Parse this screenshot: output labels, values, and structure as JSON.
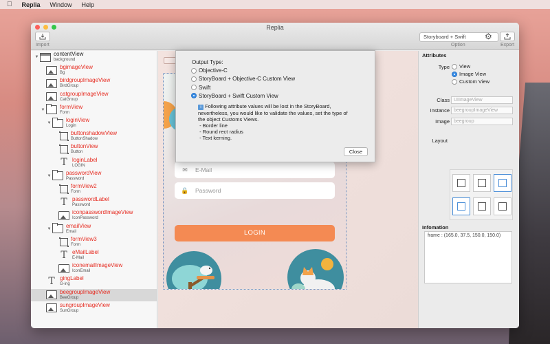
{
  "menubar": {
    "app": "Replia",
    "items": [
      "Window",
      "Help"
    ]
  },
  "window": {
    "title": "Replia",
    "toolbar": {
      "import_label": "Import",
      "option_label": "Option",
      "export_label": "Export",
      "output_selector": "Storyboard + Swift"
    }
  },
  "tree": [
    {
      "name": "contentView",
      "sub": "background",
      "icon": "view",
      "depth": 0,
      "disc": "open",
      "color": "black"
    },
    {
      "name": "bgimageView",
      "sub": "Bg",
      "icon": "image",
      "depth": 1,
      "disc": "",
      "color": "red"
    },
    {
      "name": "birdgroupImageView",
      "sub": "BirdGroup",
      "icon": "image",
      "depth": 1,
      "disc": "",
      "color": "red"
    },
    {
      "name": "catgroupImageView",
      "sub": "CatGroup",
      "icon": "image",
      "depth": 1,
      "disc": "",
      "color": "red"
    },
    {
      "name": "formView",
      "sub": "Form",
      "icon": "folder",
      "depth": 1,
      "disc": "open",
      "color": "red"
    },
    {
      "name": "loginView",
      "sub": "Login",
      "icon": "folder",
      "depth": 2,
      "disc": "open",
      "color": "red"
    },
    {
      "name": "buttonshadowView",
      "sub": "ButtonShadow",
      "icon": "button",
      "depth": 3,
      "disc": "",
      "color": "red"
    },
    {
      "name": "buttonView",
      "sub": "Button",
      "icon": "button",
      "depth": 3,
      "disc": "",
      "color": "red"
    },
    {
      "name": "loginLabel",
      "sub": "LOGIN",
      "icon": "text",
      "depth": 3,
      "disc": "",
      "color": "red"
    },
    {
      "name": "passwordView",
      "sub": "Password",
      "icon": "folder",
      "depth": 2,
      "disc": "open",
      "color": "red"
    },
    {
      "name": "formView2",
      "sub": "Form",
      "icon": "button",
      "depth": 3,
      "disc": "",
      "color": "red"
    },
    {
      "name": "passwordLabel",
      "sub": "Password",
      "icon": "text",
      "depth": 3,
      "disc": "",
      "color": "red"
    },
    {
      "name": "iconpasswordImageView",
      "sub": "IconPassword",
      "icon": "image",
      "depth": 3,
      "disc": "",
      "color": "red"
    },
    {
      "name": "emailView",
      "sub": "Email",
      "icon": "folder",
      "depth": 2,
      "disc": "open",
      "color": "red"
    },
    {
      "name": "formView3",
      "sub": "Form",
      "icon": "button",
      "depth": 3,
      "disc": "",
      "color": "red"
    },
    {
      "name": "eMailLabel",
      "sub": "E-Mail",
      "icon": "text",
      "depth": 3,
      "disc": "",
      "color": "red"
    },
    {
      "name": "iconemailImageView",
      "sub": "IconEmail",
      "icon": "image",
      "depth": 3,
      "disc": "",
      "color": "red"
    },
    {
      "name": "gingLabel",
      "sub": "G-ing",
      "icon": "text",
      "depth": 1,
      "disc": "",
      "color": "red"
    },
    {
      "name": "beegroupImageView",
      "sub": "BeeGroup",
      "icon": "image",
      "depth": 1,
      "disc": "",
      "color": "red",
      "selected": true
    },
    {
      "name": "sungroupImageView",
      "sub": "SunGroup",
      "icon": "image",
      "depth": 1,
      "disc": "",
      "color": "red"
    }
  ],
  "canvas": {
    "email_placeholder": "E-Mail",
    "password_placeholder": "Password",
    "login_button": "LOGIN"
  },
  "popup": {
    "heading": "Output Type:",
    "options": [
      {
        "label": "Objective-C",
        "selected": false
      },
      {
        "label": "StoryBoard + Objective-C Custom View",
        "selected": false
      },
      {
        "label": "Swift",
        "selected": false
      },
      {
        "label": "StoryBoard + Swift Custom View",
        "selected": true
      }
    ],
    "info_lines": [
      "Following attribute values will be lost in the StoryBoard,",
      "nevertheless, you would like to validate the values, set the type of",
      "the object Customs Views.",
      "- Border line",
      "- Round rect radius",
      "- Text kerning."
    ],
    "close_label": "Close"
  },
  "inspector": {
    "attributes_title": "Attributes",
    "type_label": "Type",
    "type_options": [
      {
        "label": "View",
        "selected": false
      },
      {
        "label": "Image View",
        "selected": true
      },
      {
        "label": "Custom View",
        "selected": false
      }
    ],
    "class_label": "Class",
    "class_placeholder": "UIImageView",
    "instance_label": "Instance",
    "instance_placeholder": "beegroupImageView",
    "image_label": "Image",
    "image_placeholder": "beegroup",
    "layout_label": "Layout",
    "infomation_title": "Infomation",
    "frame_text": "frame : (165.0, 37.5, 150.0, 150.0)"
  },
  "colors": {
    "accent": "#3a8ee6",
    "node_red": "#e62a1f",
    "login_orange": "#f48a53"
  }
}
